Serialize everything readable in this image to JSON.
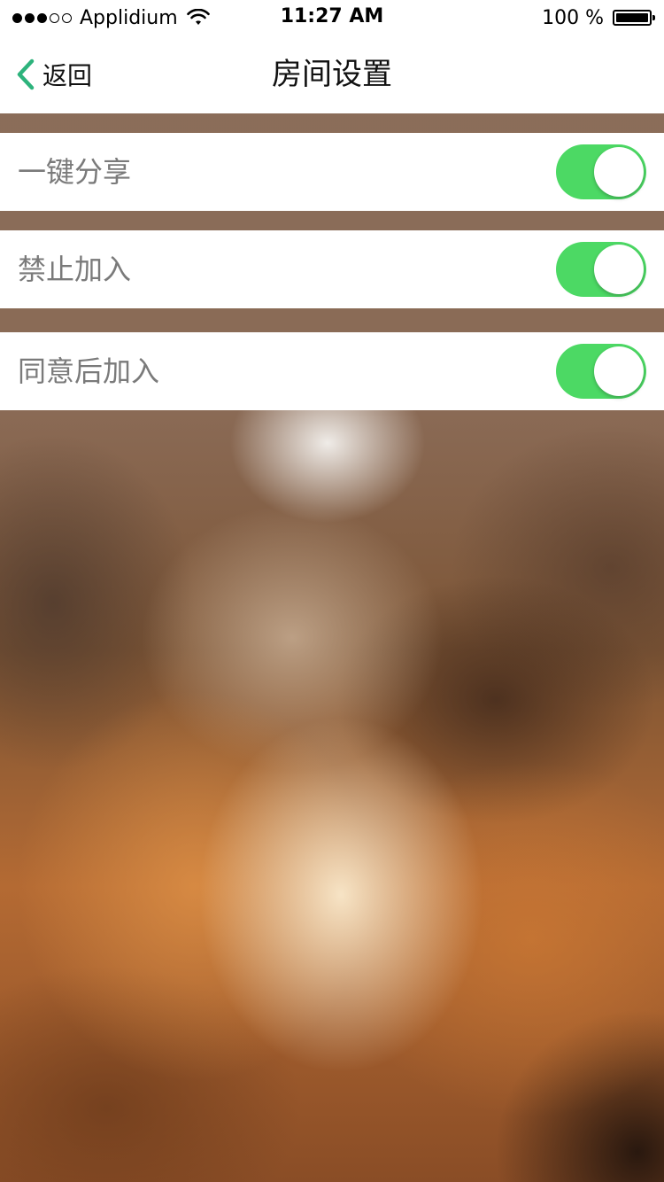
{
  "status_bar": {
    "signal_dots": [
      true,
      true,
      true,
      false,
      false
    ],
    "carrier": "Applidium",
    "wifi_icon": "wifi-icon",
    "time": "11:27 AM",
    "battery_percent": "100 %",
    "battery_level": 1.0,
    "battery_icon": "battery-icon"
  },
  "nav": {
    "back_icon": "chevron-left-icon",
    "back_label": "返回",
    "title": "房间设置",
    "accent_color": "#2db37c"
  },
  "settings": [
    {
      "label": "一键分享",
      "enabled": true
    },
    {
      "label": "禁止加入",
      "enabled": true
    },
    {
      "label": "同意后加入",
      "enabled": true
    }
  ],
  "colors": {
    "toggle_on": "#4cd964",
    "label_text": "#7a7a7a"
  }
}
